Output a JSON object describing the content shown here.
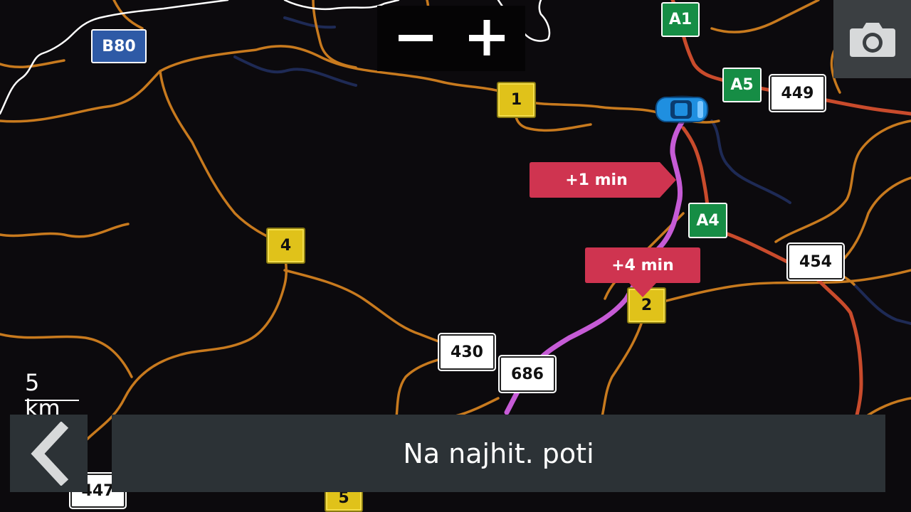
{
  "map": {
    "colors": {
      "background": "#0c0a0d",
      "regional_road": "#c87a1e",
      "highway": "#c94b2c",
      "border": "#ffffff",
      "route": "#c65bd6",
      "water": "#1e2a55"
    }
  },
  "zoom": {
    "zoom_out_icon": "minus-icon",
    "zoom_in_icon": "plus-icon"
  },
  "camera": {
    "icon": "camera-icon"
  },
  "vehicle": {
    "icon": "car-icon",
    "color": "#1f8fe0"
  },
  "shields": {
    "b80": "B80",
    "a1": "A1",
    "a5": "A5",
    "a4": "A4",
    "r1": "1",
    "r2": "2",
    "r4": "4",
    "r5": "5",
    "n449": "449",
    "n454": "454",
    "n430": "430",
    "n686": "686",
    "n447": "447"
  },
  "delays": {
    "first": "+1 min",
    "second": "+4 min"
  },
  "scale": {
    "label": "5 km"
  },
  "back": {
    "icon": "chevron-left-icon"
  },
  "status": {
    "text": "Na najhit. poti"
  }
}
